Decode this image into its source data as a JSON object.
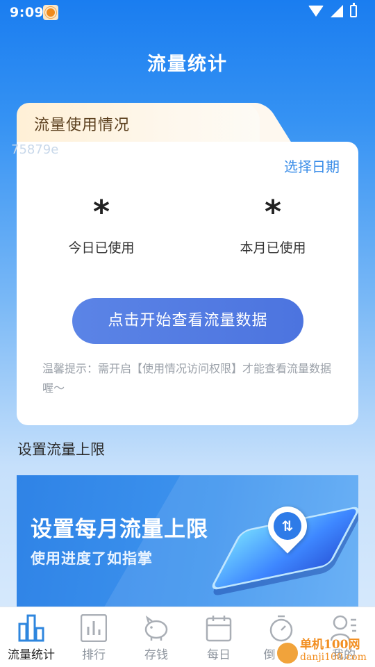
{
  "status_bar": {
    "time": "9:09"
  },
  "page": {
    "title": "流量统计"
  },
  "usage_card": {
    "tab_label": "流量使用情况",
    "watermark": "75879e",
    "select_date": "选择日期",
    "today": {
      "value": "*",
      "label": "今日已使用"
    },
    "month": {
      "value": "*",
      "label": "本月已使用"
    },
    "button_label": "点击开始查看流量数据",
    "tip": "温馨提示：需开启【使用情况访问权限】才能查看流量数据喔～"
  },
  "limit_section": {
    "title": "设置流量上限",
    "banner": {
      "headline": "设置每月流量上限",
      "subline": "使用进度了如指掌"
    }
  },
  "tabbar": {
    "items": [
      {
        "label": "流量统计",
        "icon": "bar-chart-icon",
        "active": true
      },
      {
        "label": "排行",
        "icon": "ranking-icon",
        "active": false
      },
      {
        "label": "存钱",
        "icon": "piggy-bank-icon",
        "active": false
      },
      {
        "label": "每日",
        "icon": "calendar-icon",
        "active": false
      },
      {
        "label": "倒计时",
        "icon": "stopwatch-icon",
        "active": false
      },
      {
        "label": "我的",
        "icon": "profile-icon",
        "active": false
      }
    ]
  },
  "watermark_logo": {
    "main": "单机100网",
    "url": "danji100.com"
  },
  "colors": {
    "primary": "#3a8de8",
    "button": "#5479e0",
    "active_icon": "#2e86de"
  }
}
